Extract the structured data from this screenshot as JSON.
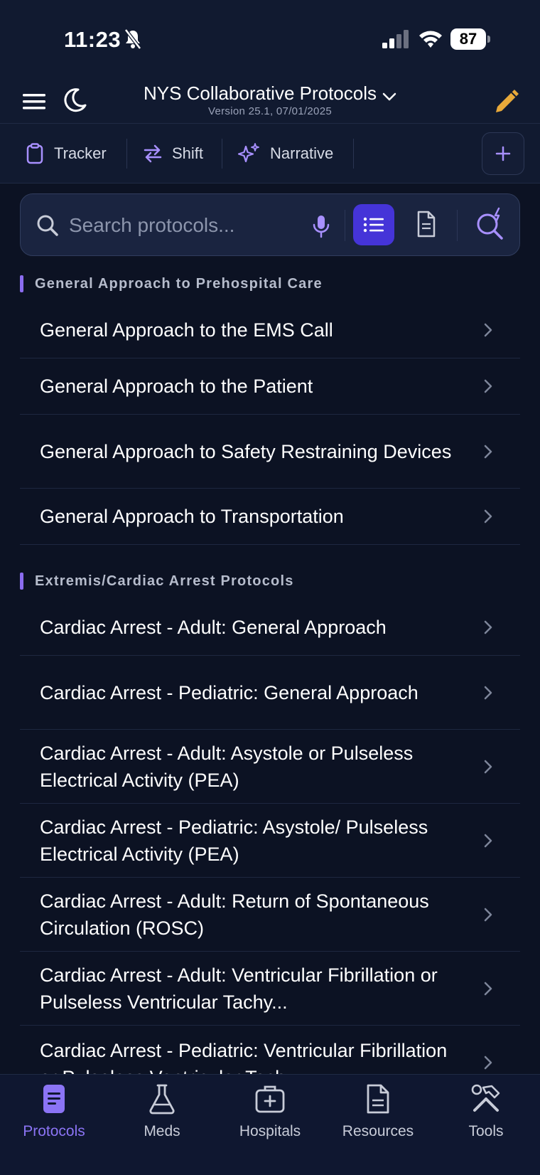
{
  "status_bar": {
    "time": "11:23",
    "battery": "87"
  },
  "header": {
    "title": "NYS Collaborative Protocols",
    "version": "Version 25.1, 07/01/2025"
  },
  "toolbar": {
    "tracker_label": "Tracker",
    "shift_label": "Shift",
    "narrative_label": "Narrative"
  },
  "search": {
    "placeholder": "Search protocols..."
  },
  "sections": [
    {
      "title": "General Approach to Prehospital Care",
      "items": [
        "General Approach to the EMS Call",
        "General Approach to the Patient",
        "General Approach to Safety Restraining Devices",
        "General Approach to Transportation"
      ]
    },
    {
      "title": "Extremis/Cardiac Arrest Protocols",
      "items": [
        "Cardiac Arrest - Adult: General Approach",
        "Cardiac Arrest - Pediatric: General Approach",
        "Cardiac Arrest - Adult: Asystole or Pulseless Electrical Activity (PEA)",
        "Cardiac Arrest - Pediatric: Asystole/ Pulseless Electrical Activity (PEA)",
        "Cardiac Arrest - Adult: Return of Spontaneous Circulation (ROSC)",
        "Cardiac Arrest - Adult: Ventricular Fibrillation or Pulseless Ventricular Tachy...",
        "Cardiac Arrest - Pediatric: Ventricular Fibrillation or Pulseless Ventricular Tach..."
      ]
    }
  ],
  "bottom_nav": {
    "protocols": "Protocols",
    "meds": "Meds",
    "hospitals": "Hospitals",
    "resources": "Resources",
    "tools": "Tools"
  },
  "colors": {
    "accent": "#4534d8",
    "accent_light": "#8b74f5",
    "background": "#0c1223",
    "pencil": "#e8a93a"
  }
}
